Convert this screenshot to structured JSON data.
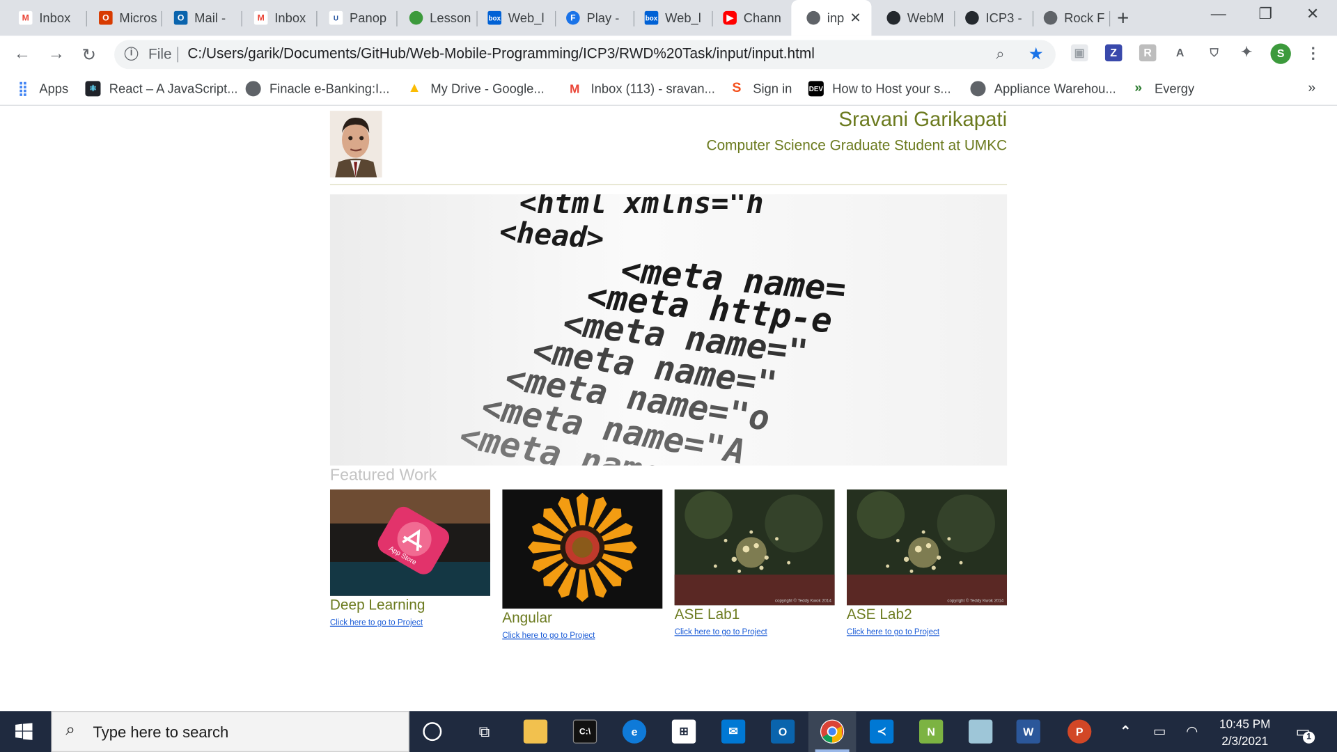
{
  "browser": {
    "tabs": [
      {
        "label": "Inbox",
        "icon": "gmail-icon"
      },
      {
        "label": "Micros",
        "icon": "office-icon"
      },
      {
        "label": "Mail -",
        "icon": "outlook-icon"
      },
      {
        "label": "Inbox",
        "icon": "gmail-icon"
      },
      {
        "label": "Panop",
        "icon": "umkc-icon"
      },
      {
        "label": "Lesson",
        "icon": "leaf-icon"
      },
      {
        "label": "Web_l",
        "icon": "box-icon"
      },
      {
        "label": "Play -",
        "icon": "f-icon"
      },
      {
        "label": "Web_l",
        "icon": "box-icon"
      },
      {
        "label": "Chann",
        "icon": "youtube-icon"
      },
      {
        "label": "inp",
        "icon": "globe-icon",
        "active": true
      },
      {
        "label": "WebM",
        "icon": "github-icon"
      },
      {
        "label": "ICP3 -",
        "icon": "github-icon"
      },
      {
        "label": "Rock F",
        "icon": "globe-icon"
      }
    ],
    "address": {
      "scheme_label": "File",
      "url": "C:/Users/garik/Documents/GitHub/Web-Mobile-Programming/ICP3/RWD%20Task/input/input.html"
    },
    "profile_initial": "S",
    "bookmarks": [
      {
        "label": "Apps",
        "icon": "apps-grid-icon"
      },
      {
        "label": "React – A JavaScript...",
        "icon": "react-icon"
      },
      {
        "label": "Finacle e-Banking:I...",
        "icon": "globe-icon"
      },
      {
        "label": "My Drive - Google...",
        "icon": "google-drive-icon"
      },
      {
        "label": "Inbox (113) - sravan...",
        "icon": "gmail-icon"
      },
      {
        "label": "Sign in",
        "icon": "s-logo-icon"
      },
      {
        "label": "How to Host your s...",
        "icon": "dev-icon"
      },
      {
        "label": "Appliance Warehou...",
        "icon": "globe-icon"
      },
      {
        "label": "Evergy",
        "icon": "evergy-icon"
      }
    ],
    "bookmarks_overflow": "»"
  },
  "page": {
    "name": "Sravani Garikapati",
    "subtitle": "Computer Science Graduate Student at UMKC",
    "hero_code_lines": [
      "<html xmlns=\"h",
      "<head>",
      "<meta name=",
      "<meta http-e",
      "<meta name=\"",
      "<meta name=\"",
      "<meta name=\"o",
      "<meta name=\"A",
      "<meta name=\"d"
    ],
    "featured_title": "Featured Work",
    "projects": [
      {
        "title": "Deep Learning",
        "link": "Click here to go to Project"
      },
      {
        "title": "Angular",
        "link": "Click here to go to Project"
      },
      {
        "title": "ASE Lab1",
        "link": "Click here to go to Project"
      },
      {
        "title": "ASE Lab2",
        "link": "Click here to go to Project"
      }
    ],
    "thumb_watermark": "copyright © Teddy Kwok 2014",
    "app_store_label": "App Store"
  },
  "taskbar": {
    "search_placeholder": "Type here to search",
    "time": "10:45 PM",
    "date": "2/3/2021",
    "notification_count": "1",
    "pinned": [
      "cortana-icon",
      "task-view-icon",
      "file-explorer-icon",
      "terminal-icon",
      "edge-icon",
      "store-icon",
      "mail-icon",
      "outlook-icon",
      "chrome-icon",
      "vscode-icon",
      "notepadpp-icon",
      "remote-icon",
      "word-icon",
      "powerpoint-icon"
    ]
  },
  "colors": {
    "accent": "#6b7a1e",
    "link": "#1a5bd6",
    "muted_heading": "#c4c4c4",
    "taskbar": "#1f2a3f"
  }
}
